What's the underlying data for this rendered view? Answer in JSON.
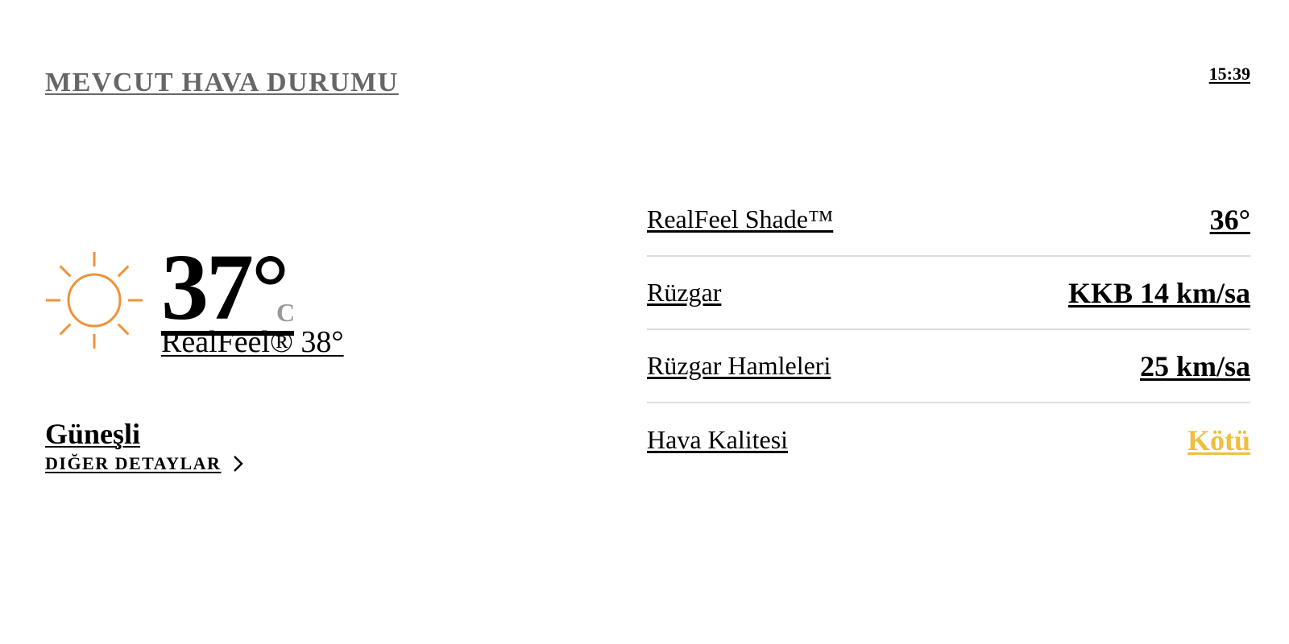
{
  "header": {
    "title": "MEVCUT HAVA DURUMU",
    "time": "15:39"
  },
  "current": {
    "icon": "sun-icon",
    "icon_color": "#F0923A",
    "temperature": "37°",
    "unit": "C",
    "realfeel": "RealFeel® 38°",
    "condition": "Güneşli",
    "more_details_label": "DIĞER DETAYLAR"
  },
  "details": [
    {
      "label": "RealFeel Shade™",
      "value": "36°",
      "value_color": "#000000"
    },
    {
      "label": "Rüzgar",
      "value": "KKB 14 km/sa",
      "value_color": "#000000"
    },
    {
      "label": "Rüzgar Hamleleri",
      "value": "25 km/sa",
      "value_color": "#000000"
    },
    {
      "label": "Hava Kalitesi",
      "value": "Kötü",
      "value_color": "#F0BE3F"
    }
  ],
  "colors": {
    "title_gray": "#666666",
    "unit_gray": "#999999",
    "divider": "#DDDDDD",
    "air_quality_bad": "#F0BE3F"
  }
}
